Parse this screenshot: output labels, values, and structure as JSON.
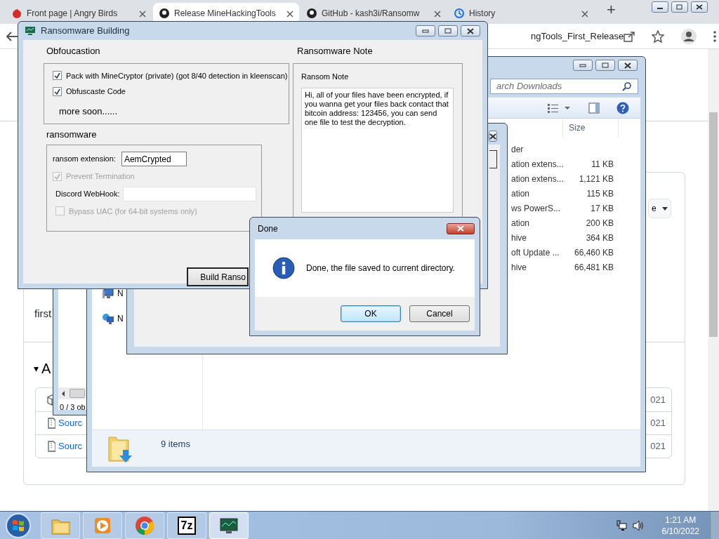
{
  "browser": {
    "tabs": [
      {
        "label": "Front page | Angry Birds",
        "selected": false,
        "kind": "bird"
      },
      {
        "label": "Release MineHackingTools",
        "selected": true,
        "kind": "github"
      },
      {
        "label": "GitHub - kash3i/Ransomw",
        "selected": false,
        "kind": "github"
      },
      {
        "label": "History",
        "selected": false,
        "kind": "history"
      }
    ],
    "new_tab": "+",
    "address": "ngTools_First_Release",
    "page": {
      "dropdown_label": "e",
      "paragraph": "first",
      "section_marker": "▾",
      "section_heading": "A",
      "assets": [
        {
          "kind": "package",
          "date": "021"
        },
        {
          "kind": "zip",
          "link": "Sourc",
          "date": "021"
        },
        {
          "kind": "zip",
          "link": "Sourc",
          "date": "021"
        }
      ]
    }
  },
  "back_window": {
    "status": "0 / 3 ob"
  },
  "explorer": {
    "search_placeholder": "arch Downloads",
    "size_column": "Size",
    "rows": [
      {
        "name": "der"
      },
      {
        "name": "ation extens...",
        "size": "11 KB"
      },
      {
        "name": "ation extens...",
        "size": "1,121 KB"
      },
      {
        "name": "ation",
        "size": "115 KB"
      },
      {
        "name": "ws PowerS...",
        "size": "17 KB"
      },
      {
        "name": "ation",
        "size": "200 KB"
      },
      {
        "name": "hive",
        "size": "364 KB"
      },
      {
        "name": "oft Update ...",
        "size": "66,460 KB"
      },
      {
        "name": "hive",
        "size": "66,481 KB"
      }
    ],
    "nav_items": [
      {
        "kind": "computer",
        "label": "N"
      },
      {
        "kind": "network",
        "label": "N"
      }
    ],
    "status": "9 items"
  },
  "builder": {
    "title": "Ransomware Building",
    "obfuscation_heading": "Obfoucastion",
    "obfuscation_options": [
      {
        "label": "Pack with MineCryptor (private) (got 8/40 detection in kleenscan)",
        "checked": true,
        "disabled": false
      },
      {
        "label": "Obfuscaste Code",
        "checked": true,
        "disabled": false
      }
    ],
    "more_note": "more soon......",
    "ransomware_heading": "ransomware",
    "extension_label": "ransom extension:",
    "extension_value": "AemCrypted",
    "prevent_termination": {
      "label": "Prevent Termination",
      "checked": true,
      "disabled": true
    },
    "webhook_label": "Discord WebHook:",
    "bypass_uac": {
      "label": "Bypass UAC (for 64-bit systems only)",
      "checked": false,
      "disabled": true
    },
    "build_button": "Build Ranso",
    "note_heading": "Ransomware Note",
    "note_label": "Ransom Note",
    "note_text": "Hi, all of your files have been encrypted, if you wanna get your files back contact that bitcoin address: 123456, you can send one file to test the decryption."
  },
  "dialog": {
    "title": "Done",
    "message": "Done, the file saved to current directory.",
    "buttons": [
      {
        "label": "OK",
        "default": true
      },
      {
        "label": "Cancel",
        "default": false
      }
    ]
  },
  "taskbar": {
    "apps": [
      {
        "kind": "explorer",
        "selected": false
      },
      {
        "kind": "media",
        "selected": false
      },
      {
        "kind": "chrome",
        "selected": false
      },
      {
        "kind": "sevenzip",
        "label": "7z",
        "selected": false
      },
      {
        "kind": "monitor",
        "selected": true
      }
    ],
    "time": "1:21 AM",
    "date": "6/10/2022"
  }
}
